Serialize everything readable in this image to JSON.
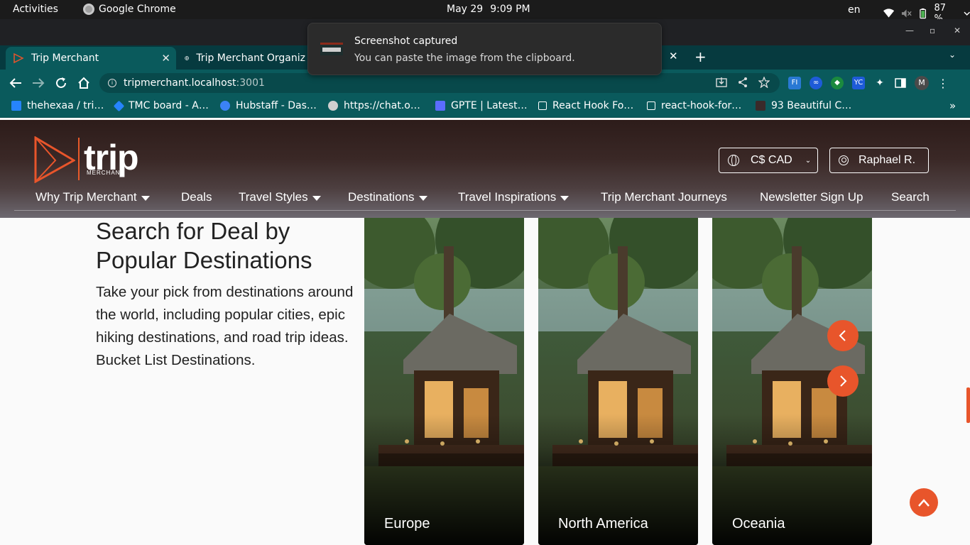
{
  "system_bar": {
    "activities": "Activities",
    "app_name": "Google Chrome",
    "date": "May 29",
    "time": "9:09 PM",
    "language": "en",
    "battery": "87 %"
  },
  "browser": {
    "tabs": [
      {
        "title": "Trip Merchant",
        "active": true
      },
      {
        "title": "Trip Merchant Organiz",
        "active": false
      }
    ],
    "url_host": "tripmerchant.localhost",
    "url_port": ":3001",
    "bookmarks": [
      {
        "label": "thehexaa / tri…",
        "icon": "bitbucket-icon",
        "color": "#2684ff"
      },
      {
        "label": "TMC board - A…",
        "icon": "jira-icon",
        "color": "#2684ff"
      },
      {
        "label": "Hubstaff - Das…",
        "icon": "hubstaff-icon",
        "color": "#3b82f6"
      },
      {
        "label": "https://chat.o…",
        "icon": "openai-icon",
        "color": "#cccccc"
      },
      {
        "label": "GPTE | Latest…",
        "icon": "gpte-icon",
        "color": "#5b6cff"
      },
      {
        "label": "React Hook Fo…",
        "icon": "page-icon",
        "color": "#000000"
      },
      {
        "label": "react-hook-for…",
        "icon": "page-icon",
        "color": "#000000"
      },
      {
        "label": "93 Beautiful C…",
        "icon": "site-icon",
        "color": "#3a2a2a"
      }
    ],
    "profile_initial": "M"
  },
  "notification": {
    "title": "Screenshot captured",
    "body": "You can paste the image from the clipboard."
  },
  "site": {
    "logo_word": "trip",
    "logo_sub": "MERCHANT",
    "currency": "C$ CAD",
    "user": "Raphael R.",
    "nav": [
      {
        "label": "Why Trip Merchant",
        "dropdown": true
      },
      {
        "label": "Deals",
        "dropdown": false
      },
      {
        "label": "Travel Styles",
        "dropdown": true
      },
      {
        "label": "Destinations",
        "dropdown": true
      },
      {
        "label": "Travel Inspirations",
        "dropdown": true
      },
      {
        "label": "Trip Merchant Journeys",
        "dropdown": false
      },
      {
        "label": "Newsletter Sign Up",
        "dropdown": false
      },
      {
        "label": "Search",
        "dropdown": false
      }
    ],
    "accent_color": "#e8552b"
  },
  "section": {
    "heading": "Search for Deal by Popular Destinations",
    "description": "Take your pick from destinations around the world, including popular cities, epic hiking destinations, and road trip ideas. Bucket List Destinations.",
    "cards": [
      {
        "label": "Europe"
      },
      {
        "label": "North America"
      },
      {
        "label": "Oceania"
      }
    ]
  }
}
